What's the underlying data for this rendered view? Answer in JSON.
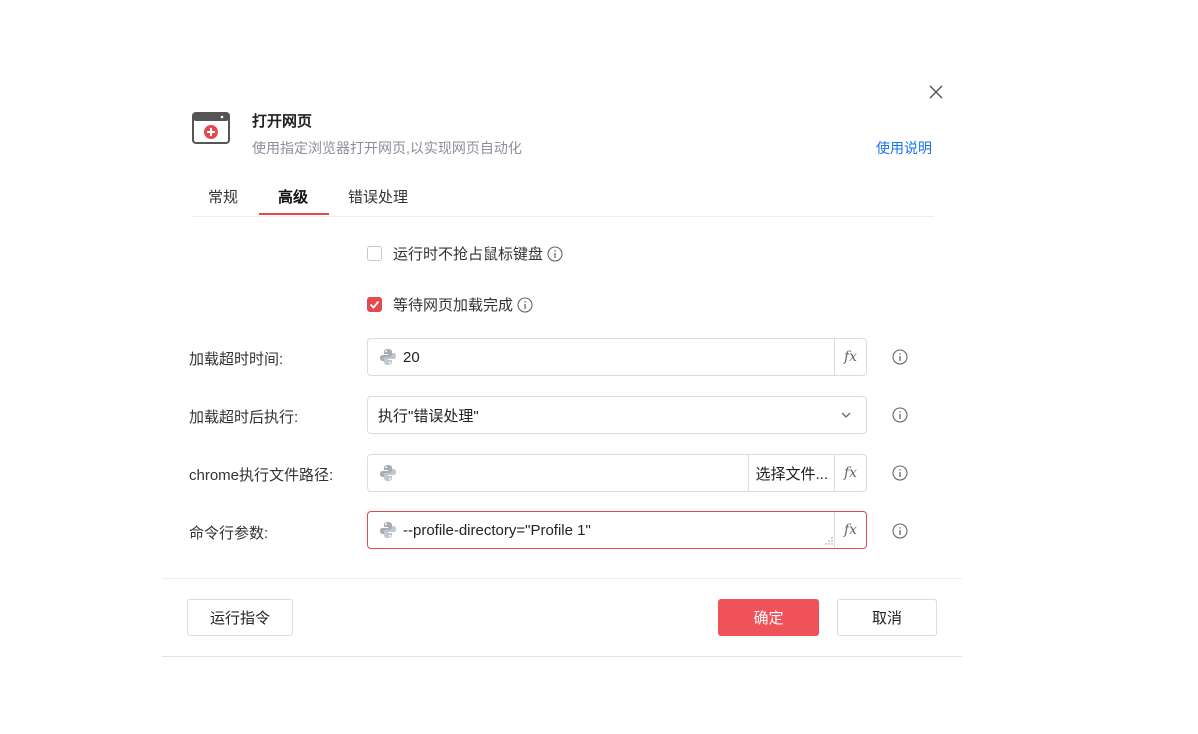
{
  "dialog": {
    "title": "打开网页",
    "subtitle": "使用指定浏览器打开网页,以实现网页自动化",
    "help_link": "使用说明",
    "tabs": [
      {
        "label": "常规",
        "active": false
      },
      {
        "label": "高级",
        "active": true
      },
      {
        "label": "错误处理",
        "active": false
      }
    ]
  },
  "options": {
    "no_grab_mouse": {
      "label": "运行时不抢占鼠标键盘",
      "checked": false
    },
    "wait_page_load": {
      "label": "等待网页加载完成",
      "checked": true
    }
  },
  "fields": {
    "load_timeout": {
      "label": "加载超时时间:",
      "value": "20"
    },
    "timeout_action": {
      "label": "加载超时后执行:",
      "value": "执行\"错误处理\""
    },
    "chrome_path": {
      "label": "chrome执行文件路径:",
      "value": "",
      "file_button": "选择文件..."
    },
    "cmd_args": {
      "label": "命令行参数:",
      "value": "--profile-directory=\"Profile 1\""
    }
  },
  "fx_label": "fx",
  "footer": {
    "run_button": "运行指令",
    "confirm_button": "确定",
    "cancel_button": "取消"
  },
  "colors": {
    "accent": "#e5484d",
    "primary_button": "#f0525a",
    "link": "#1a73e8"
  },
  "icons": {
    "header": "browser-window-icon",
    "close": "close-icon",
    "info": "info-icon",
    "python": "python-icon",
    "dropdown": "chevron-down-icon"
  }
}
